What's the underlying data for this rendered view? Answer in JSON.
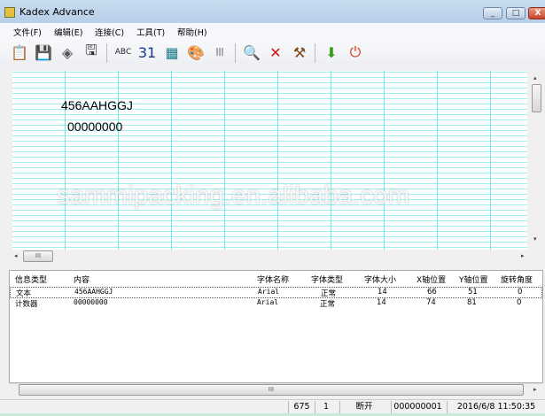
{
  "window": {
    "title": "Kadex Advance",
    "minimize": "_",
    "maximize": "□",
    "close": "X"
  },
  "menu": [
    "文件(F)",
    "编辑(E)",
    "连接(C)",
    "工具(T)",
    "帮助(H)"
  ],
  "toolbar": [
    {
      "name": "clipboard-icon",
      "glyph": "📋"
    },
    {
      "name": "import-icon",
      "glyph": "💾"
    },
    {
      "name": "eraser-icon",
      "glyph": "◈"
    },
    {
      "name": "save-all-icon",
      "glyph": "🖫"
    },
    {
      "name": "abc-font-icon",
      "glyph": "ABC"
    },
    {
      "name": "calendar-icon",
      "glyph": "31"
    },
    {
      "name": "counter-icon",
      "glyph": "▦"
    },
    {
      "name": "palette-icon",
      "glyph": "🎨"
    },
    {
      "name": "barcode-icon",
      "glyph": "|||"
    },
    {
      "name": "search-icon",
      "glyph": "🔍"
    },
    {
      "name": "delete-icon",
      "glyph": "✕"
    },
    {
      "name": "tools-icon",
      "glyph": "⚒"
    },
    {
      "name": "download-icon",
      "glyph": "⬇"
    },
    {
      "name": "power-icon",
      "glyph": "⏻"
    }
  ],
  "canvas": {
    "items": [
      "456AAHGGJ",
      "00000000"
    ]
  },
  "watermark": "sammipacking.en.alibaba.com",
  "table": {
    "columns": [
      "信息类型",
      "内容",
      "字体名称",
      "字体类型",
      "字体大小",
      "X轴位置",
      "Y轴位置",
      "旋转角度"
    ],
    "rows": [
      [
        "文本",
        "456AAHGGJ",
        "Arial",
        "正常",
        "14",
        "66",
        "51",
        "0"
      ],
      [
        "计数器",
        "00000000",
        "Arial",
        "正常",
        "14",
        "74",
        "81",
        "0"
      ]
    ]
  },
  "status": [
    "",
    "675",
    "1",
    "断开",
    "000000001",
    "2016/6/8 11:50:35"
  ],
  "scroll": {
    "thumb": "III",
    "left": "◂",
    "right": "▸",
    "up": "▴",
    "down": "▾"
  }
}
